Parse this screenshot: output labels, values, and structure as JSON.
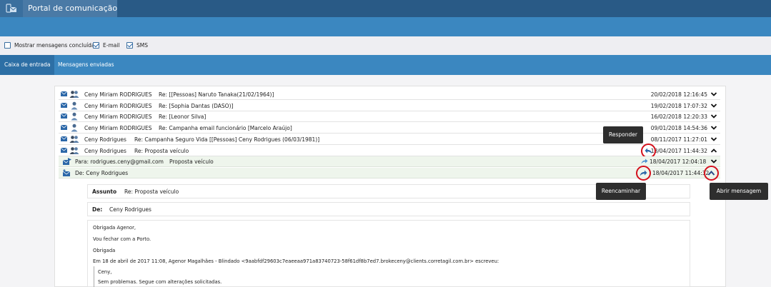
{
  "app": {
    "title": "Portal de comunicação"
  },
  "filters": [
    {
      "label": "Mostrar mensagens concluídas",
      "checked": false
    },
    {
      "label": "E-mail",
      "checked": true
    },
    {
      "label": "SMS",
      "checked": true
    }
  ],
  "tabs": [
    {
      "label": "Caixa de entrada",
      "active": true
    },
    {
      "label": "Mensagens enviadas",
      "active": false
    }
  ],
  "messages": [
    {
      "from": "Ceny Miriam RODRIGUES",
      "subject": "Re: [[Pessoas] Naruto Tanaka(21/02/1964)]",
      "date": "20/02/2018 12:16:45"
    },
    {
      "from": "Ceny Miriam RODRIGUES",
      "subject": "Re: [Sophia Dantas (DASO)]",
      "date": "19/02/2018 17:07:32"
    },
    {
      "from": "Ceny Miriam RODRIGUES",
      "subject": "Re: [Leonor Silva]",
      "date": "16/02/2018 12:20:33"
    },
    {
      "from": "Ceny Miriam RODRIGUES",
      "subject": "Re: Campanha email funcionário [Marcelo Araújo]",
      "date": "09/01/2018 14:54:36"
    },
    {
      "from": "Ceny Rodrigues",
      "subject": "Re: Campanha Seguro Vida [[Pessoas] Ceny Rodrigues (06/03/1981)]",
      "date": "08/11/2017 11:27:01"
    },
    {
      "from": "Ceny Rodrigues",
      "subject": "Re: Proposta veículo",
      "date": "18/04/2017 11:44:32"
    }
  ],
  "thread": {
    "sent": {
      "to": "Para: rodrigues.ceny@gmail.com",
      "subject": "Proposta veículo",
      "date": "18/04/2017 12:04:18"
    },
    "received": {
      "from": "De: Ceny Rodrigues",
      "date": "18/04/2017 11:44:32"
    }
  },
  "detail": {
    "subject_label": "Assunto",
    "subject_value": "Re: Proposta veículo",
    "from_label": "De:",
    "from_value": "Ceny Rodrigues",
    "body": [
      "Obrigada Agenor,",
      "Vou fechar com a Porto.",
      "Obrigada",
      "Em 18 de abril de 2017 11:08, Agenor Magalhães - Blindado <9aabfdf29603c7eaeeaa971a83740723-58f61df8b7ed7.brokeceny@clients.corretagil.com.br> escreveu:"
    ],
    "quote": [
      "Ceny,",
      "Sem problemas. Segue com alterações solicitadas."
    ]
  },
  "tooltips": {
    "reply": "Responder",
    "forward": "Reencaminhar",
    "open": "Abrir mensagem"
  },
  "colors": {
    "header": "#295a86",
    "bar": "#3b87c0",
    "accent_ring": "#d3101c",
    "icon_blue": "#2b67a8"
  }
}
